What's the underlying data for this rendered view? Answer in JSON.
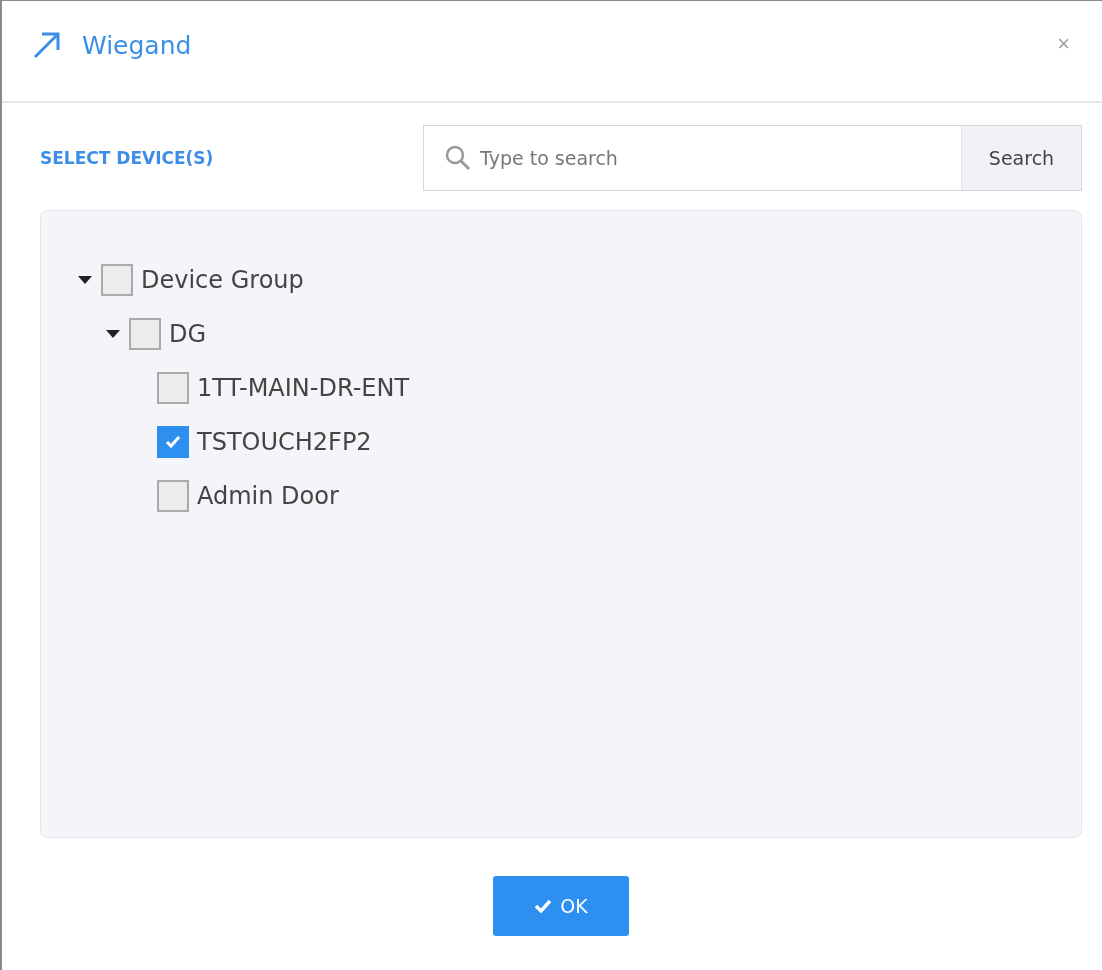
{
  "dialog": {
    "title": "Wiegand",
    "close": "×"
  },
  "section_label": "SELECT DEVICE(S)",
  "search": {
    "placeholder": "Type to search",
    "button": "Search"
  },
  "tree": [
    {
      "label": "Device Group",
      "expanded": true,
      "checked": false,
      "children": [
        {
          "label": "DG",
          "expanded": true,
          "checked": false,
          "children": [
            {
              "label": "1TT-MAIN-DR-ENT",
              "checked": false
            },
            {
              "label": "TSTOUCH2FP2",
              "checked": true
            },
            {
              "label": "Admin Door",
              "checked": false
            }
          ]
        }
      ]
    }
  ],
  "ok_button": "OK"
}
